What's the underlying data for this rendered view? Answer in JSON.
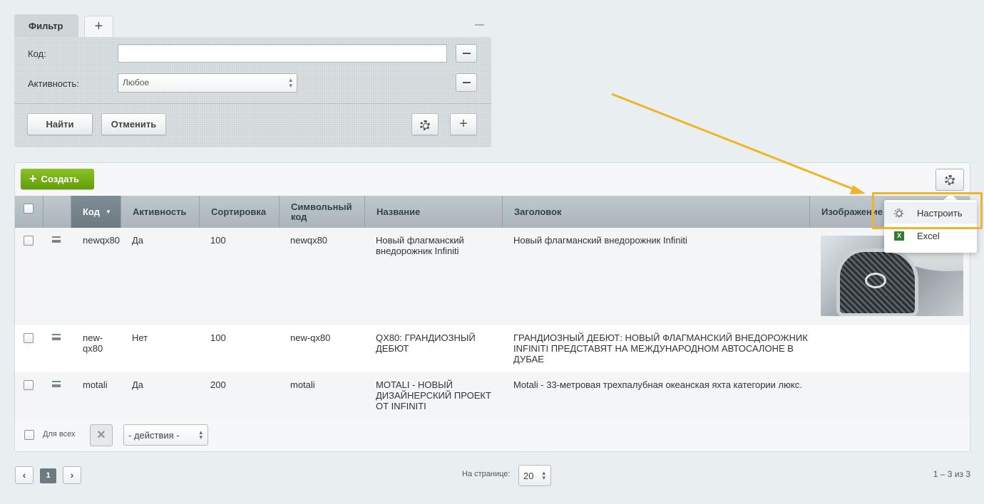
{
  "filter": {
    "tab_active": "Фильтр",
    "tab_add": "+",
    "fields": [
      {
        "label": "Код:",
        "value": ""
      },
      {
        "label": "Активность:",
        "value": "Любое"
      }
    ],
    "find_label": "Найти",
    "cancel_label": "Отменить",
    "add_label": "+"
  },
  "grid": {
    "create_label": "Создать",
    "columns": [
      "Код",
      "Активность",
      "Сортировка",
      "Символьный код",
      "Название",
      "Заголовок",
      "Изображение"
    ],
    "rows": [
      {
        "code": "newqx80",
        "active": "Да",
        "sort": "100",
        "symbol": "newqx80",
        "name": "Новый флагманский внедорожник Infiniti",
        "title": "Новый флагманский внедорожник Infiniti",
        "has_image": true
      },
      {
        "code": "new-qx80",
        "active": "Нет",
        "sort": "100",
        "symbol": "new-qx80",
        "name": "QX80: ГРАНДИОЗНЫЙ ДЕБЮТ",
        "title": "ГРАНДИОЗНЫЙ ДЕБЮТ: НОВЫЙ ФЛАГМАНСКИЙ ВНЕДОРОЖНИК INFINITI ПРЕДСТАВЯТ НА МЕЖДУНАРОДНОМ АВТОСАЛОНЕ В ДУБАЕ",
        "has_image": false
      },
      {
        "code": "motali",
        "active": "Да",
        "sort": "200",
        "symbol": "motali",
        "name": "MOTALI - НОВЫЙ ДИЗАЙНЕРСКИЙ ПРОЕКТ ОТ INFINITI",
        "title": "Motali - 33-метровая трехпалубная океанская яхта категории люкс.",
        "has_image": false
      }
    ],
    "footer": {
      "for_all_label": "Для всех",
      "action_select": "- действия -"
    }
  },
  "menu": {
    "items": [
      {
        "label": "Настроить",
        "icon": "gear-icon"
      },
      {
        "label": "Excel",
        "icon": "excel-icon"
      }
    ]
  },
  "pagination": {
    "current_page": "1",
    "per_page_label": "На странице:",
    "per_page_value": "20",
    "total_label": "1 – 3 из 3"
  },
  "colors": {
    "create_button": "#649d0b",
    "highlight_box": "#f0b428",
    "header_bg": "#aab4ba",
    "sorted_header_bg": "#6c7a82"
  }
}
